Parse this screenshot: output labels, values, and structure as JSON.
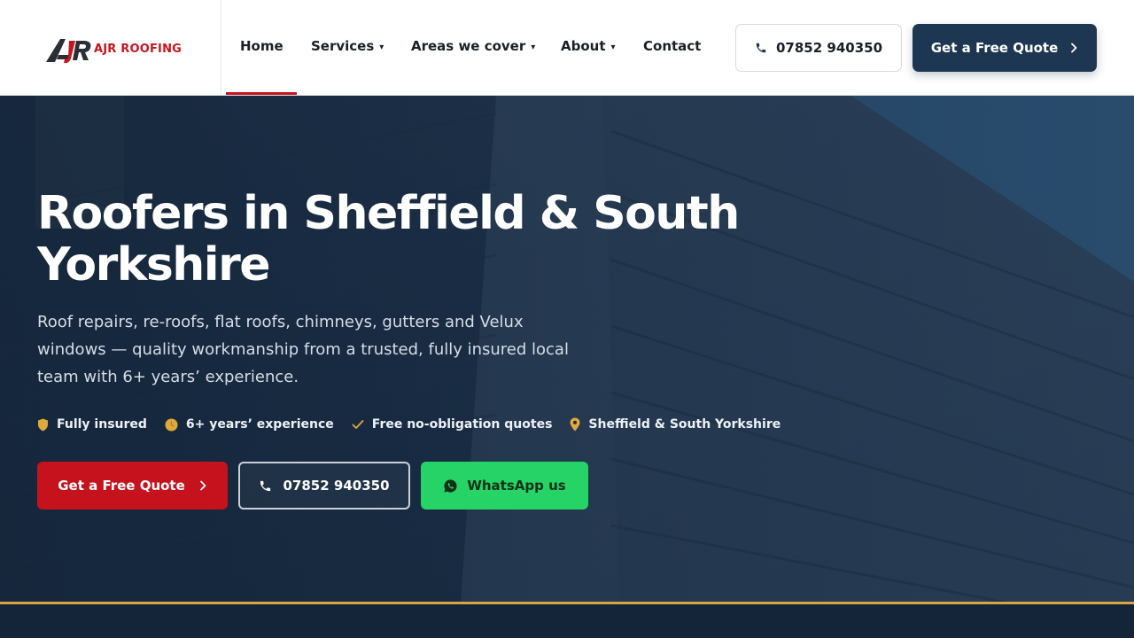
{
  "brand": {
    "name": "AJR ROOFING",
    "red": "#c8141e",
    "navy": "#1d3651",
    "gold": "#d9a441"
  },
  "nav": {
    "items": [
      {
        "label": "Home",
        "active": true
      },
      {
        "label": "Services",
        "caret": "▾"
      },
      {
        "label": "Areas we cover",
        "caret": "▾"
      },
      {
        "label": "About",
        "caret": "▾"
      },
      {
        "label": "Contact"
      }
    ]
  },
  "header": {
    "phone_label": "07852 940350",
    "quote_label": "Get a Free Quote",
    "phone_icon": "phone-icon",
    "quote_icon": "chevron-right-icon"
  },
  "hero": {
    "title": "Roofers in Sheffield & South Yorkshire",
    "subtitle": "Roof repairs, re-roofs, flat roofs, chimneys, gutters and Velux windows — quality workmanship from a trusted, fully insured local team with 6+ years’ experience.",
    "badges": [
      {
        "icon": "shield-icon",
        "label": "Fully insured"
      },
      {
        "icon": "clock-icon",
        "label": "6+ years’ experience"
      },
      {
        "icon": "check-icon",
        "label": "Free no-obligation quotes"
      },
      {
        "icon": "location-pin-icon",
        "label": "Sheffield & South Yorkshire"
      }
    ],
    "buttons": {
      "quote_label": "Get a Free Quote",
      "phone_label": "07852 940350",
      "whatsapp_label": "WhatsApp us"
    }
  }
}
